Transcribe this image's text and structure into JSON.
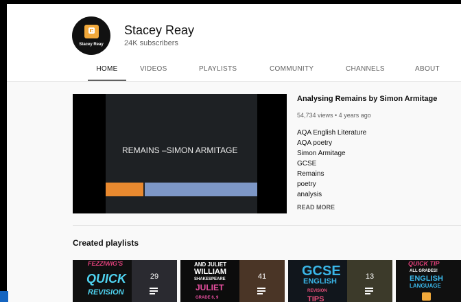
{
  "channel": {
    "avatar_text": "Stacey Reay",
    "name": "Stacey Reay",
    "subscribers": "24K subscribers"
  },
  "tabs": [
    "HOME",
    "VIDEOS",
    "PLAYLISTS",
    "COMMUNITY",
    "CHANNELS",
    "ABOUT"
  ],
  "active_tab": "HOME",
  "featured": {
    "slide_text": "REMAINS –SIMON ARMITAGE",
    "title": "Analysing Remains by Simon Armitage",
    "meta": "54,734 views • 4 years ago",
    "description": [
      "AQA English Literature",
      "AQA poetry",
      "Simon Armitage",
      "GCSE",
      "Remains",
      "poetry",
      "analysis"
    ],
    "read_more": "READ MORE"
  },
  "section_title": "Created playlists",
  "playlists": [
    {
      "art_lines": [
        "FEZZIWIG'S",
        "QUICK",
        "REVISION"
      ],
      "count": "29"
    },
    {
      "art_lines": [
        "AND JULIET",
        "WILLIAM",
        "SHAKESPEARE",
        "JULIET",
        "GRADE 6, 9"
      ],
      "count": "41"
    },
    {
      "art_lines": [
        "GCSE",
        "ENGLISH",
        "REVISION",
        "TIPS"
      ],
      "count": "13"
    },
    {
      "art_lines": [
        "QUICK TIP",
        "ALL GRADES!",
        "ENGLISH",
        "LANGUAGE"
      ],
      "count": ""
    }
  ],
  "colors": {
    "accent_orange": "#e8892f",
    "slide_blue": "#7d97c6",
    "active_tab_underline": "#606060"
  }
}
